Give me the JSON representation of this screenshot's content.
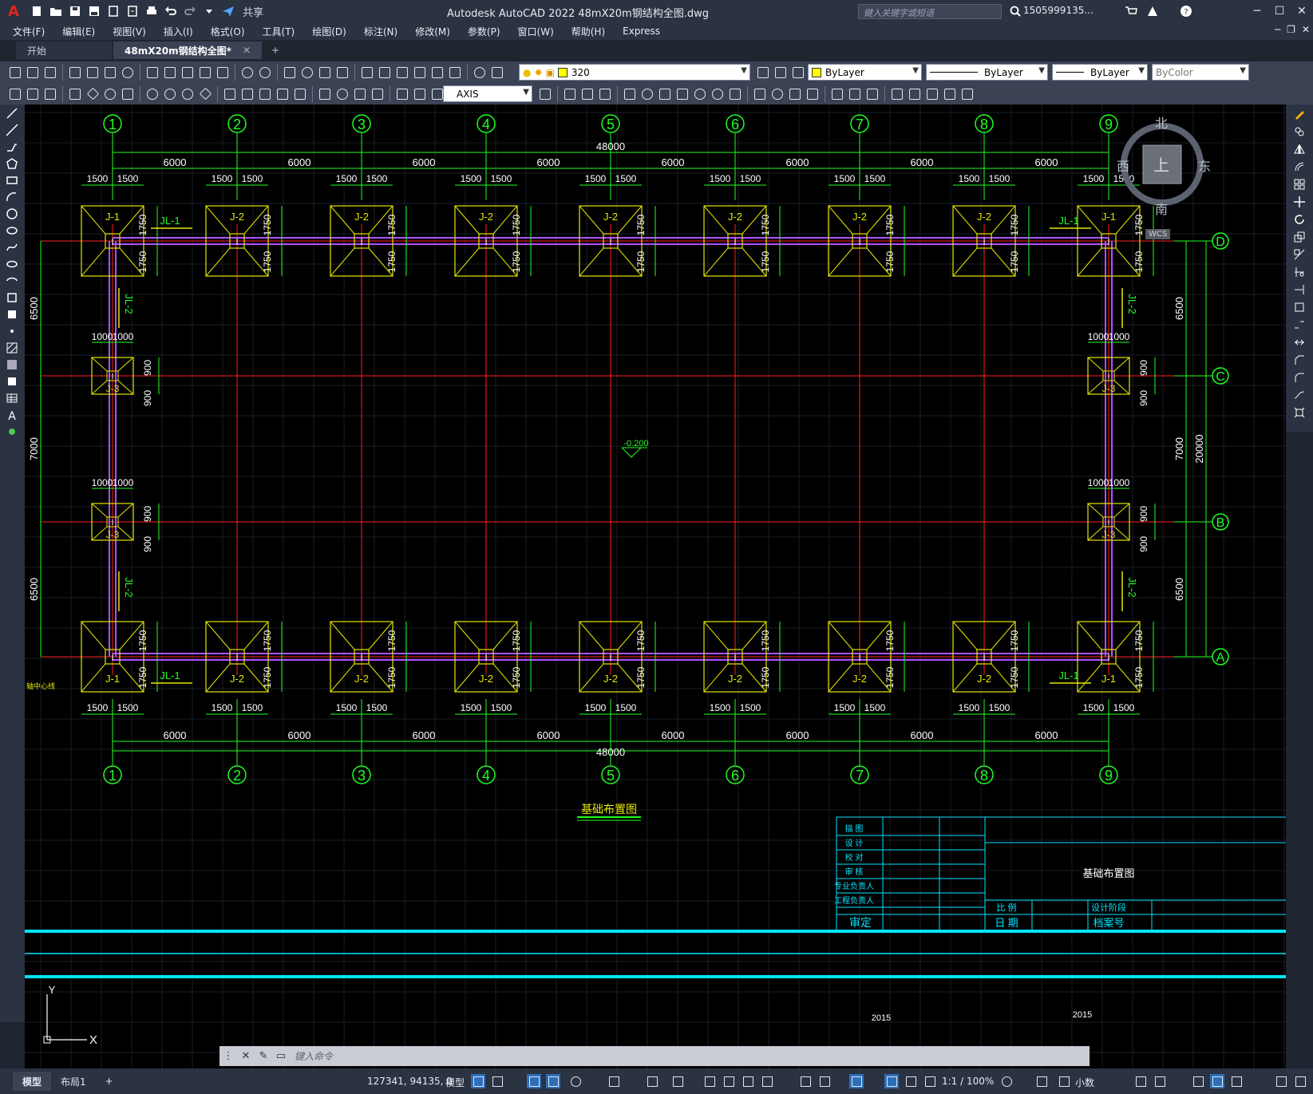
{
  "app": {
    "title": "Autodesk AutoCAD 2022    48mX20m钢结构全图.dwg",
    "logo": "A",
    "share_label": "共享",
    "search_placeholder": "键入关键字或短语",
    "user": "1505999135...",
    "window_buttons": [
      "─",
      "☐",
      "✕"
    ]
  },
  "menu": {
    "items": [
      "文件(F)",
      "编辑(E)",
      "视图(V)",
      "插入(I)",
      "格式(O)",
      "工具(T)",
      "绘图(D)",
      "标注(N)",
      "修改(M)",
      "参数(P)",
      "窗口(W)",
      "帮助(H)",
      "Express"
    ],
    "mdi_buttons": [
      "─",
      "❐",
      "✕"
    ]
  },
  "tabs": {
    "items": [
      {
        "label": "开始",
        "active": false,
        "closable": false
      },
      {
        "label": "48mX20m钢结构全图*",
        "active": true,
        "closable": true
      }
    ],
    "new_tab": "+"
  },
  "toolbar": {
    "layer_value": "320",
    "color_value": "ByLayer",
    "linetype_value": "ByLayer",
    "lineweight_value": "ByLayer",
    "plotstyle_value": "ByColor",
    "dimstyle_value": "AXIS"
  },
  "viewcube": {
    "north": "北",
    "south": "南",
    "east": "东",
    "west": "西",
    "top": "上",
    "wcs": "WCS"
  },
  "drawing": {
    "colors": {
      "grid_axis": "#ff2020",
      "dimension": "#20ff20",
      "footing": "#e6e600",
      "beam": "#b050ff",
      "title_block": "#00e5ff",
      "text": "#ffffff"
    },
    "column_labels": [
      "1",
      "2",
      "3",
      "4",
      "5",
      "6",
      "7",
      "8",
      "9"
    ],
    "row_labels": [
      "D",
      "C",
      "B",
      "A"
    ],
    "bay_dims": [
      "6000",
      "6000",
      "6000",
      "6000",
      "6000",
      "6000",
      "6000",
      "6000"
    ],
    "total_length": "48000",
    "footing_half": "1500",
    "footing_vert": "1750",
    "side_dims": [
      "6500",
      "7000",
      "6500"
    ],
    "total_width": "20000",
    "small_footing_h": "1000",
    "small_footing_v": "900",
    "beam_label_jl1": "JL-1",
    "beam_label_jl2": "JL-2",
    "footing_j1": "J-1",
    "footing_j2": "J-2",
    "footing_j3": "J-3",
    "elevation": "-0.200",
    "axis_note": "轴中心线",
    "plan_title": "基础布置图",
    "title_block": {
      "rows": [
        "描  图",
        "设  计",
        "校  对",
        "审  核",
        "专业负责人",
        "工程负责人"
      ],
      "approve": "审定",
      "scale_label": "比  例",
      "date_label": "日  期",
      "stage_label": "设计阶段",
      "archive_label": "档案号",
      "sheet_title": "基础布置图",
      "year": "2015"
    },
    "ucs_x": "X",
    "ucs_y": "Y"
  },
  "command": {
    "placeholder": "键入命令"
  },
  "status": {
    "tabs": [
      {
        "label": "模型",
        "active": true
      },
      {
        "label": "布局1",
        "active": false
      }
    ],
    "add_tab": "+",
    "coords": "127341, 94135, 0",
    "mode": "模型",
    "scale": "1:1 / 100%",
    "units": "小数"
  }
}
